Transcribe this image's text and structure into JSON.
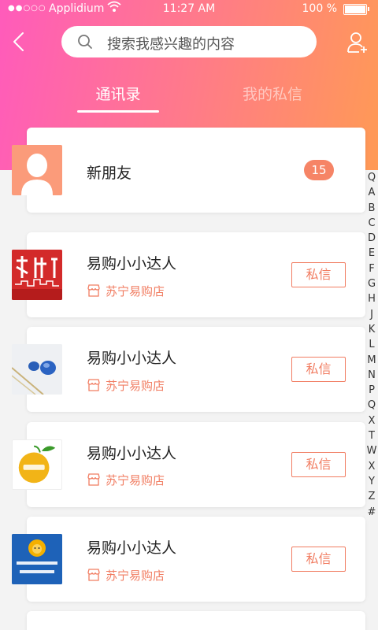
{
  "status_bar": {
    "signal": "●●○○○",
    "carrier": "Applidium",
    "wifi": "wifi-icon",
    "time": "11:27 AM",
    "battery": "100 %"
  },
  "header": {
    "search_placeholder": "搜索我感兴趣的内容",
    "tabs": [
      {
        "label": "通讯录",
        "active": true
      },
      {
        "label": "我的私信",
        "active": false
      }
    ]
  },
  "new_friends": {
    "label": "新朋友",
    "badge": "15"
  },
  "contacts": [
    {
      "name": "易购小小达人",
      "store": "苏宁易购店",
      "action": "私信"
    },
    {
      "name": "易购小小达人",
      "store": "苏宁易购店",
      "action": "私信"
    },
    {
      "name": "易购小小达人",
      "store": "苏宁易购店",
      "action": "私信"
    },
    {
      "name": "易购小小达人",
      "store": "苏宁易购店",
      "action": "私信"
    }
  ],
  "index_letters": [
    "Q",
    "A",
    "B",
    "C",
    "D",
    "E",
    "F",
    "G",
    "H",
    "J",
    "K",
    "L",
    "M",
    "N",
    "P",
    "Q",
    "X",
    "T",
    "W",
    "X",
    "Y",
    "Z",
    "#"
  ],
  "colors": {
    "gradient_start": "#ff5bbb",
    "gradient_end": "#ff9a55",
    "accent": "#f17d62",
    "badge": "#f68466"
  }
}
